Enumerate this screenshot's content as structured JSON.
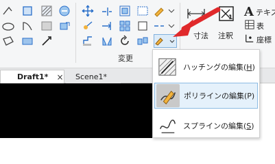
{
  "ribbon": {
    "modify_group_label": "変更",
    "annotation_label": "注釈",
    "text_label": "テキス",
    "table_label": "表",
    "coord_label": "座標",
    "dimension_label": "寸法"
  },
  "dropdown": {
    "items": [
      {
        "label": "ハッチングの編集(",
        "key": "H",
        "tail": ")"
      },
      {
        "label": "ポリラインの編集(P)"
      },
      {
        "label": "スプラインの編集(",
        "key": "S",
        "tail": ")"
      }
    ]
  },
  "tabs": [
    {
      "label": "Draft1*",
      "close": "×"
    },
    {
      "label": "Scene1*"
    }
  ],
  "colors": {
    "accent_red": "#e0292b",
    "highlight": "#e5f1fb",
    "icon_blue": "#2a6fc9"
  }
}
